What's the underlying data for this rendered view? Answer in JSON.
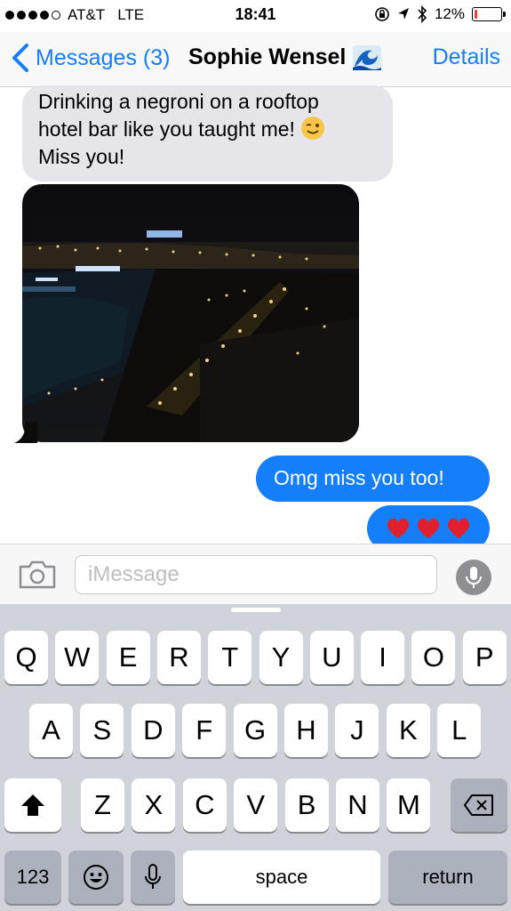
{
  "status_bar": {
    "carrier": "AT&T",
    "network": "LTE",
    "time": "18:41",
    "battery_percent": "12%",
    "battery_level": 0.12,
    "signal_bars": 4,
    "icons": [
      "signal-dots",
      "rotation-lock-icon",
      "location-arrow-icon",
      "bluetooth-icon",
      "battery-icon"
    ],
    "battery_color": "#ff3b30"
  },
  "nav": {
    "back_label": "Messages (3)",
    "contact_name": "Sophie Wensel",
    "contact_emoji": "wave-icon",
    "details_label": "Details",
    "accent_color": "#147efb"
  },
  "messages": [
    {
      "direction": "incoming",
      "type": "text",
      "lines": [
        "Drinking a negroni on a rooftop",
        "hotel bar like you taught me!",
        "Miss you!"
      ],
      "emoji": "wink-face-icon"
    },
    {
      "direction": "incoming",
      "type": "photo",
      "description_icon": "night-city-photo"
    },
    {
      "direction": "outgoing",
      "type": "text",
      "text": "Omg miss you too!"
    },
    {
      "direction": "outgoing",
      "type": "emoji",
      "emoji": [
        "heart-icon",
        "heart-icon",
        "heart-icon"
      ]
    }
  ],
  "composer": {
    "placeholder": "iMessage",
    "value": ""
  },
  "keyboard": {
    "row1": [
      "Q",
      "W",
      "E",
      "R",
      "T",
      "Y",
      "U",
      "I",
      "O",
      "P"
    ],
    "row2": [
      "A",
      "S",
      "D",
      "F",
      "G",
      "H",
      "J",
      "K",
      "L"
    ],
    "row3": [
      "Z",
      "X",
      "C",
      "V",
      "B",
      "N",
      "M"
    ],
    "numbers_label": "123",
    "space_label": "space",
    "return_label": "return"
  }
}
